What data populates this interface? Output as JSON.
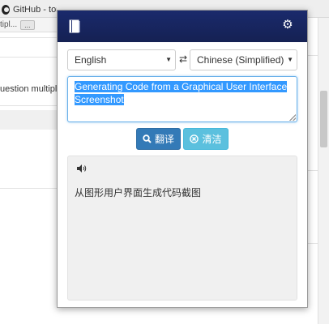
{
  "browser": {
    "tab_title": "GitHub - tony",
    "bookmark_text": "tipl...",
    "bookmark_more": "...",
    "question_text": "uestion multipl"
  },
  "popup": {
    "header_icons": [
      "book-icon",
      "gear-icon"
    ],
    "source_language": "English",
    "target_language": "Chinese (Simplified)",
    "source_text": "Generating Code from a Graphical User Interface Screenshot",
    "translate_label": "翻译",
    "clear_label": "清洁",
    "result_text": "从图形用户界面生成代码截图"
  },
  "colors": {
    "header": "#1a2a6c",
    "translate_button": "#337ab7",
    "clear_button": "#5bc0de",
    "selection": "#3399ff"
  }
}
